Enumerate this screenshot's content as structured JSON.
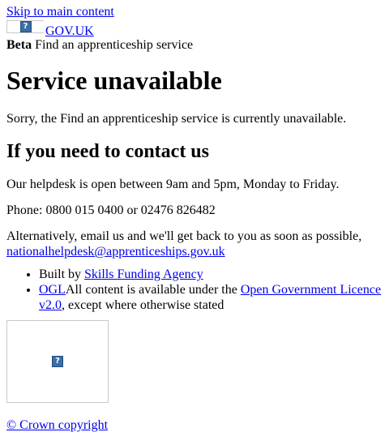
{
  "skip_link": "Skip to main content",
  "header": {
    "logo_alt_icon": "broken-image-icon",
    "govuk_link": "GOV.UK"
  },
  "phase_banner": {
    "tag": "Beta",
    "service_name": "Find an apprenticeship service"
  },
  "main": {
    "heading": "Service unavailable",
    "intro": "Sorry, the Find an apprenticeship service is currently unavailable.",
    "contact_heading": "If you need to contact us",
    "helpdesk_hours": "Our helpdesk is open between 9am and 5pm, Monday to Friday.",
    "phone": "Phone: 0800 015 0400 or 02476 826482",
    "email_text": "Alternatively, email us and we'll get back to you as soon as possible,",
    "email_link": "nationalhelpdesk@apprenticeships.gov.uk"
  },
  "footer": {
    "built_by_prefix": "Built by",
    "built_by_link": "Skills Funding Agency",
    "ogl_link": "OGL",
    "licence_prefix": "All content is available under the",
    "licence_link": "Open Government Licence v2.0",
    "licence_suffix": ", except where otherwise stated",
    "crest_icon": "broken-image-icon",
    "copyright_link": "© Crown copyright"
  },
  "colors": {
    "link": "#0000ee",
    "text": "#000000",
    "background": "#ffffff",
    "placeholder_border": "#c8c8c8",
    "broken_image_icon": "#3a6ea5"
  }
}
